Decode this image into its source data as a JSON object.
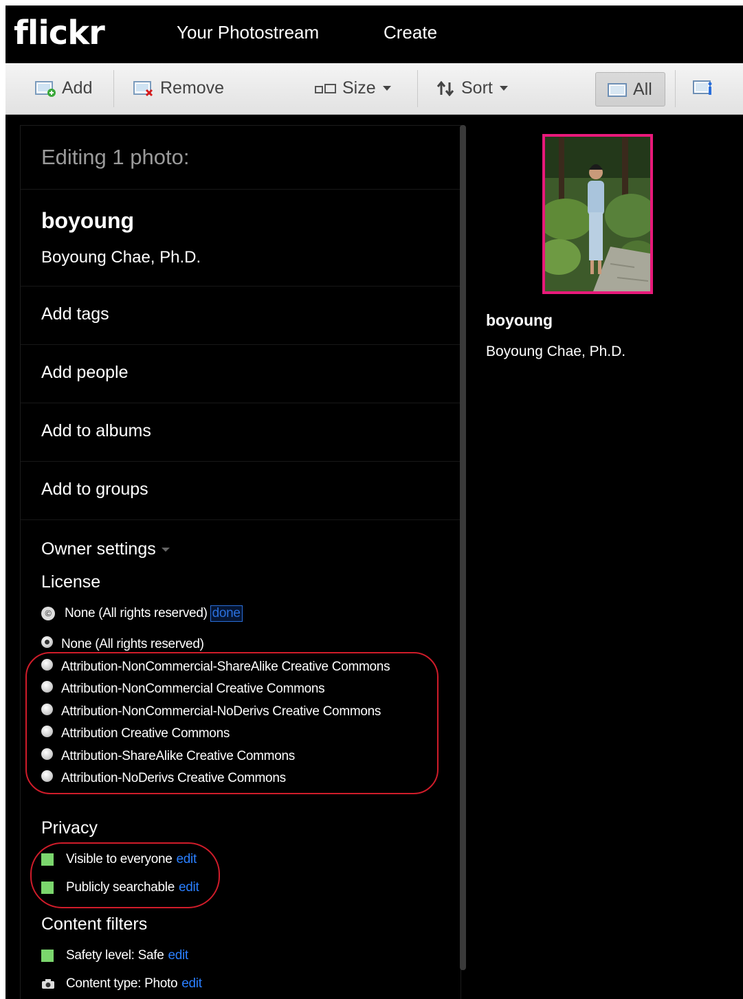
{
  "nav": {
    "logo": "flickr",
    "links": [
      "Your Photostream",
      "Create"
    ]
  },
  "toolbar": {
    "add": "Add",
    "remove": "Remove",
    "size": "Size",
    "sort": "Sort",
    "all": "All"
  },
  "panel": {
    "heading": "Editing 1 photo:",
    "photo_title": "boyoung",
    "photo_description": "Boyoung Chae, Ph.D.",
    "rows": [
      "Add tags",
      "Add people",
      "Add to albums",
      "Add to groups"
    ],
    "owner_settings": "Owner settings",
    "license": {
      "label": "License",
      "current": "None (All rights reserved)",
      "done": "done",
      "options": [
        "None (All rights reserved)",
        "Attribution-NonCommercial-ShareAlike Creative Commons",
        "Attribution-NonCommercial Creative Commons",
        "Attribution-NonCommercial-NoDerivs Creative Commons",
        "Attribution Creative Commons",
        "Attribution-ShareAlike Creative Commons",
        "Attribution-NoDerivs Creative Commons"
      ],
      "selected_index": 0
    },
    "privacy": {
      "label": "Privacy",
      "visible": "Visible to everyone",
      "searchable": "Publicly searchable",
      "edit": "edit"
    },
    "content_filters": {
      "label": "Content filters",
      "safety": "Safety level: Safe",
      "content_type": "Content type: Photo",
      "edit": "edit"
    }
  },
  "right": {
    "title": "boyoung",
    "description": "Boyoung Chae, Ph.D."
  },
  "colors": {
    "highlight_border": "#e8197a",
    "annotation": "#d01c2a",
    "status_green": "#7bd66d",
    "link": "#2a7fff"
  }
}
